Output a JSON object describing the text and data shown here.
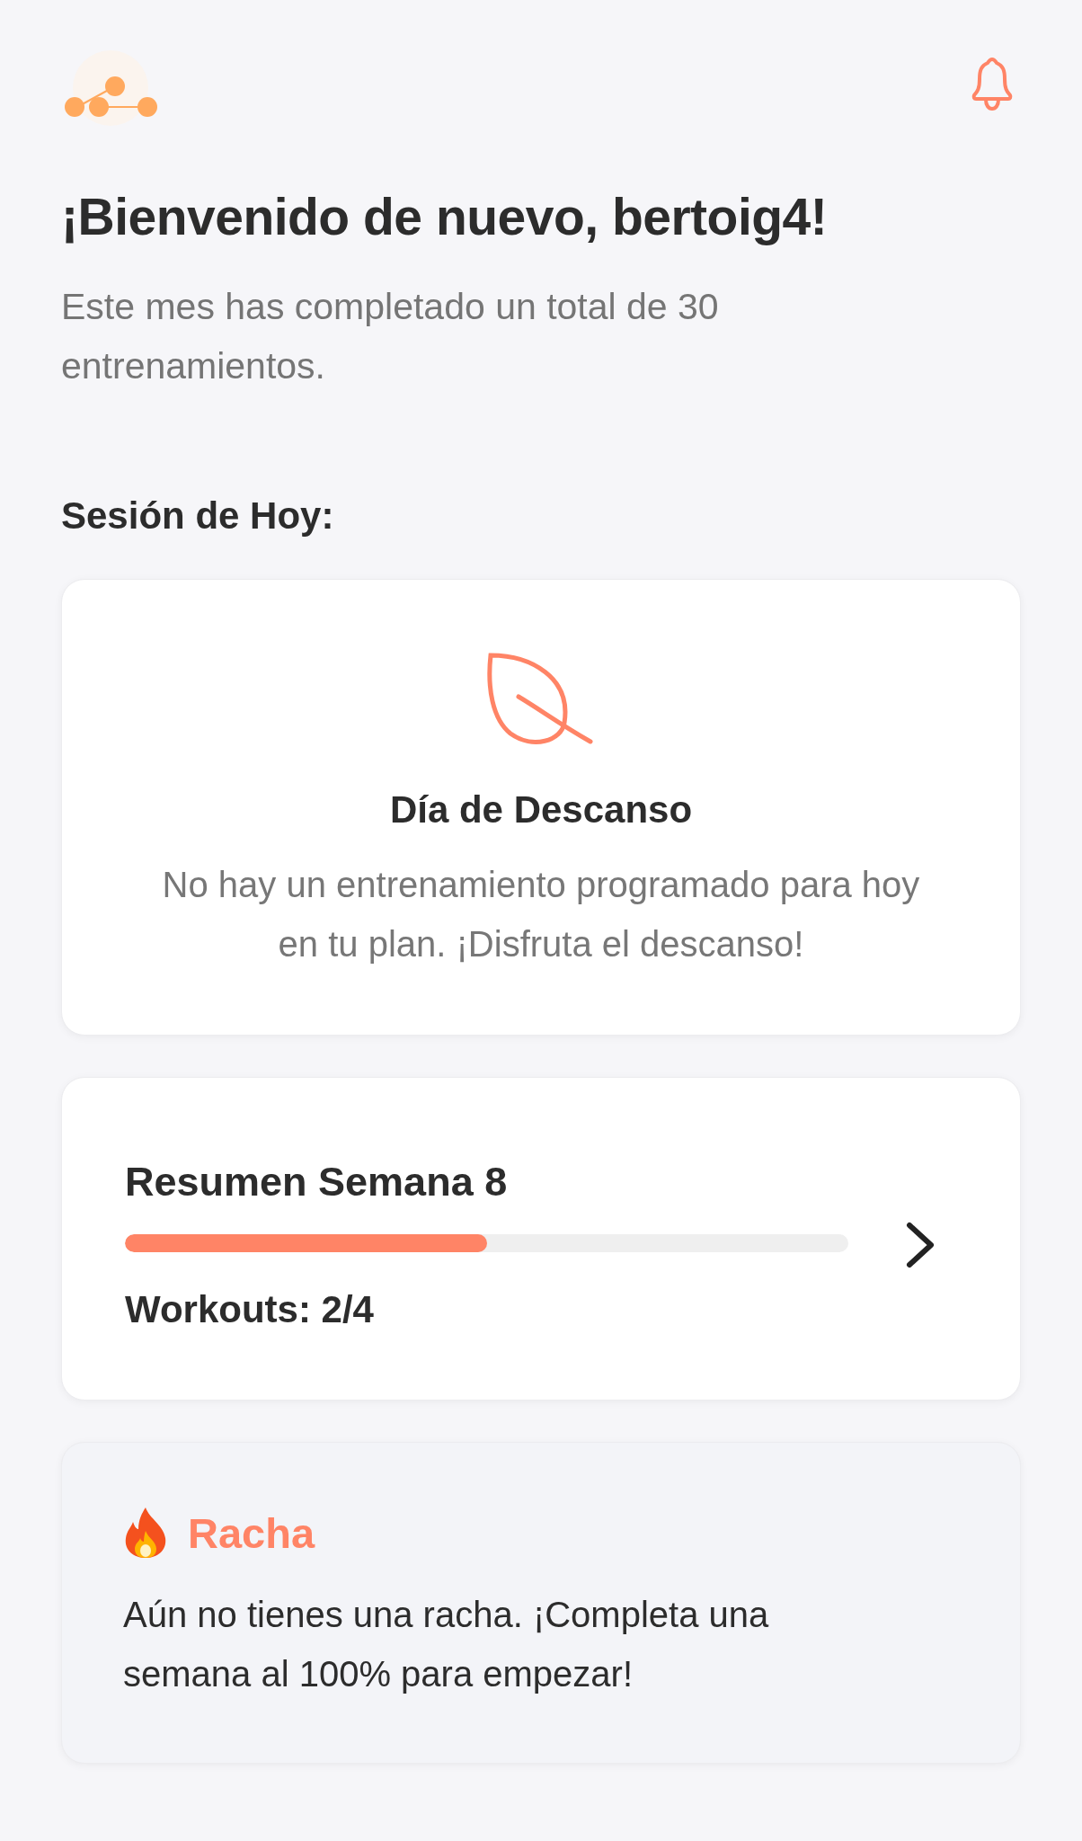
{
  "greeting": {
    "title": "¡Bienvenido de nuevo, bertoig4!",
    "subtitle": "Este mes has completado un total de 30 entrenamientos."
  },
  "today": {
    "heading": "Sesión de Hoy:",
    "title": "Día de Descanso",
    "description": "No hay un entrenamiento programado para hoy en tu plan. ¡Disfruta el descanso!"
  },
  "week_summary": {
    "title": "Resumen Semana 8",
    "level": 0.5,
    "workouts": "Workouts: 2/4"
  },
  "streak": {
    "title": "Racha",
    "text": "Aún no tienes una racha. ¡Completa una semana al 100% para empezar!"
  }
}
